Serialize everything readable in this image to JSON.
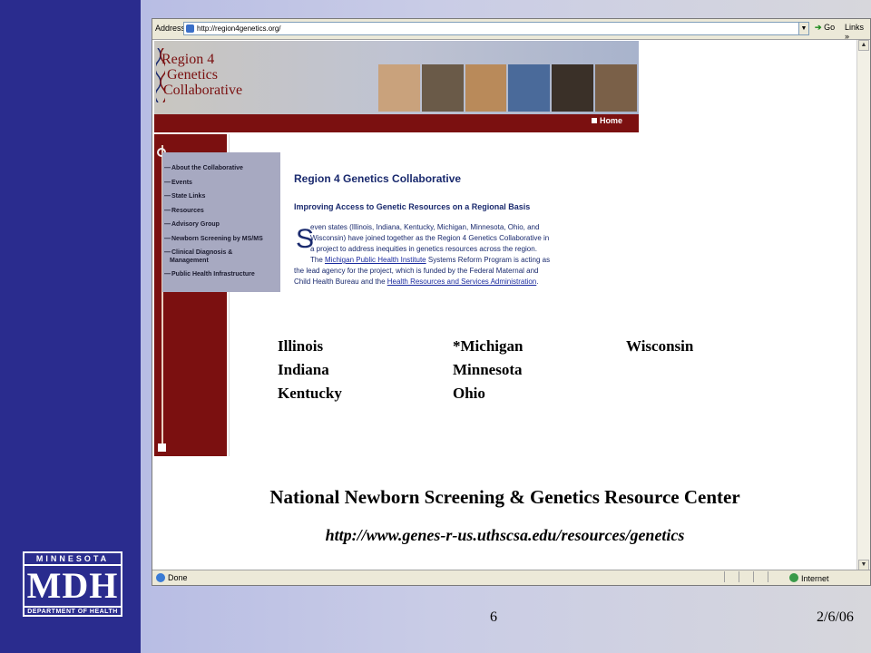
{
  "slide": {
    "number": "6",
    "date": "2/6/06"
  },
  "logo": {
    "top": "MINNESOTA",
    "main": "MDH",
    "bottom": "DEPARTMENT OF HEALTH"
  },
  "browser": {
    "address_label": "Address",
    "address_value": "http://region4genetics.org/",
    "go_label": "Go",
    "links_label": "Links",
    "links_chevron": "»",
    "status_text": "Done",
    "zone_label": "Internet"
  },
  "webpage": {
    "logo_lines": [
      "Region 4",
      "Genetics",
      "Collaborative"
    ],
    "home_label": "Home",
    "nav_items": [
      "About the Collaborative",
      "Events",
      "State Links",
      "Resources",
      "Advisory Group",
      "Newborn Screening by MS/MS",
      "Clinical Diagnosis &",
      "Management",
      "Public Health Infrastructure"
    ],
    "title": "Region 4 Genetics Collaborative",
    "subtitle": "Improving Access to Genetic Resources on a Regional Basis",
    "body_dropcap": "S",
    "body_line1": "even states (Illinois, Indiana, Kentucky, Michigan, Minnesota, Ohio, and",
    "body_line2": "Wisconsin) have joined together as the Region 4 Genetics Collaborative in",
    "body_line3": "a project to address inequities in genetics resources across the region.",
    "body_line4_pre": "The ",
    "body_link1": "Michigan Public Health Institute",
    "body_line4_post": " Systems Reform Program is acting as",
    "body_line5": "the lead agency for the project, which is funded by the Federal Maternal and",
    "body_line6_pre": "Child Health Bureau and the ",
    "body_link2": "Health Resources and Services Administration",
    "body_line6_post": "."
  },
  "states": {
    "col1": [
      "Illinois",
      "Indiana",
      "Kentucky"
    ],
    "col2": [
      "*Michigan",
      "Minnesota",
      "Ohio"
    ],
    "col3": [
      "Wisconsin"
    ]
  },
  "footer": {
    "title": "National Newborn Screening & Genetics Resource Center",
    "url": "http://www.genes-r-us.uthscsa.edu/resources/genetics"
  },
  "colors": {
    "sidebar": "#2a2c8e",
    "maroon": "#7b1010",
    "nav_bg": "#a7a9c1",
    "text_blue": "#1a2a6e"
  }
}
